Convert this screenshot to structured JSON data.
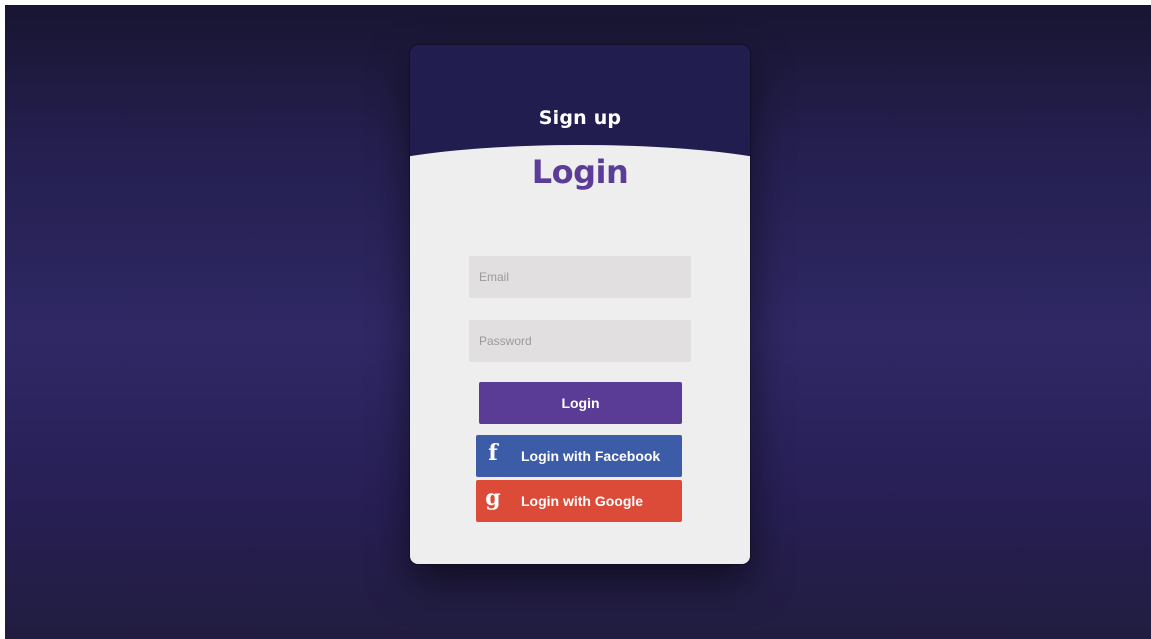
{
  "colors": {
    "background_top": "#181531",
    "background_mid": "#2f2865",
    "card_header": "#221d4f",
    "panel": "#eeeeee",
    "login_title": "#5b3d99",
    "login_button": "#5a3b95",
    "facebook": "#3d5ca8",
    "google": "#dc4a38"
  },
  "signup": {
    "title": "Sign up"
  },
  "login": {
    "title": "Login",
    "email_placeholder": "Email",
    "password_placeholder": "Password",
    "submit_label": "Login",
    "facebook": {
      "icon": "facebook-icon",
      "glyph": "f",
      "label": "Login with Facebook"
    },
    "google": {
      "icon": "google-icon",
      "glyph": "g",
      "label": "Login with Google"
    }
  }
}
